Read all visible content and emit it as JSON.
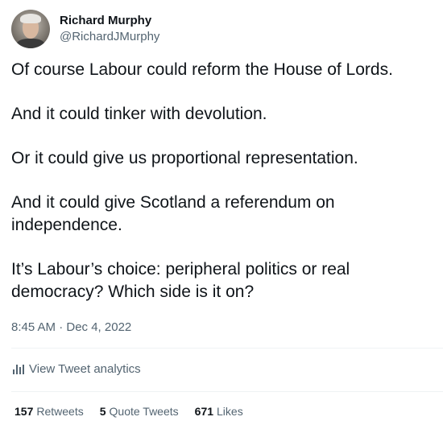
{
  "author": {
    "display_name": "Richard Murphy",
    "handle": "@RichardJMurphy"
  },
  "tweet": {
    "paragraphs": [
      "Of course Labour could reform the House of Lords.",
      "And it could tinker with devolution.",
      "Or it could give us proportional representation.",
      "And it could give Scotland a referendum on independence.",
      "It’s Labour’s choice: peripheral politics or real democracy? Which side is it on?"
    ],
    "timestamp": "8:45 AM · Dec 4, 2022"
  },
  "analytics": {
    "icon": "bar-chart-icon",
    "label": "View Tweet analytics"
  },
  "stats": {
    "retweets_count": "157",
    "retweets_label": "Retweets",
    "quotes_count": "5",
    "quotes_label": "Quote Tweets",
    "likes_count": "671",
    "likes_label": "Likes"
  }
}
